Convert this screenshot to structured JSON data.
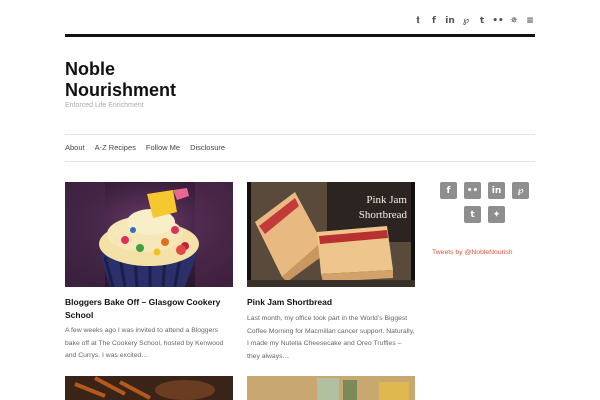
{
  "social_top": [
    {
      "icon": "twitter-icon",
      "glyph": "𝐭"
    },
    {
      "icon": "facebook-icon",
      "glyph": "f"
    },
    {
      "icon": "linkedin-icon",
      "glyph": "in"
    },
    {
      "icon": "pinterest-icon",
      "glyph": "℘"
    },
    {
      "icon": "tumblr-icon",
      "glyph": "t"
    },
    {
      "icon": "flickr-icon",
      "glyph": "••"
    },
    {
      "icon": "yelp-icon",
      "glyph": "✵"
    },
    {
      "icon": "rss-icon",
      "glyph": "≡"
    }
  ],
  "site": {
    "title": "Noble Nourishment",
    "tagline": "Enforced Life Enrichment"
  },
  "nav": [
    "About",
    "A-Z Recipes",
    "Follow Me",
    "Disclosure"
  ],
  "posts": [
    {
      "title": "Bloggers Bake Off – Glasgow Cookery School",
      "excerpt": "A few weeks ago I was invited to attend a Bloggers bake off at The Cookery School, hosted by Kenwood and Currys. I was excited…"
    },
    {
      "title": "Pink Jam Shortbread",
      "excerpt": "Last month, my office took part in the World’s Biggest Coffee Morning for Macmillan cancer support. Naturally, I made my Nutella Cheesecake and Oreo Truffles – they always…",
      "image_caption": "Pink Jam Shortbread"
    }
  ],
  "sidebar": {
    "icons": [
      {
        "icon": "facebook-icon",
        "glyph": "f"
      },
      {
        "icon": "flickr-icon",
        "glyph": "••"
      },
      {
        "icon": "linkedin-icon",
        "glyph": "in"
      },
      {
        "icon": "pinterest-icon",
        "glyph": "℘"
      },
      {
        "icon": "tumblr-icon",
        "glyph": "t"
      },
      {
        "icon": "twitter-icon",
        "glyph": "✦"
      }
    ],
    "tweets_link": "Tweets by @NobleNourish"
  },
  "colors": {
    "accent": "#e0533d",
    "rule": "#111111",
    "sidebar_icon_bg": "#8e8e8e"
  }
}
